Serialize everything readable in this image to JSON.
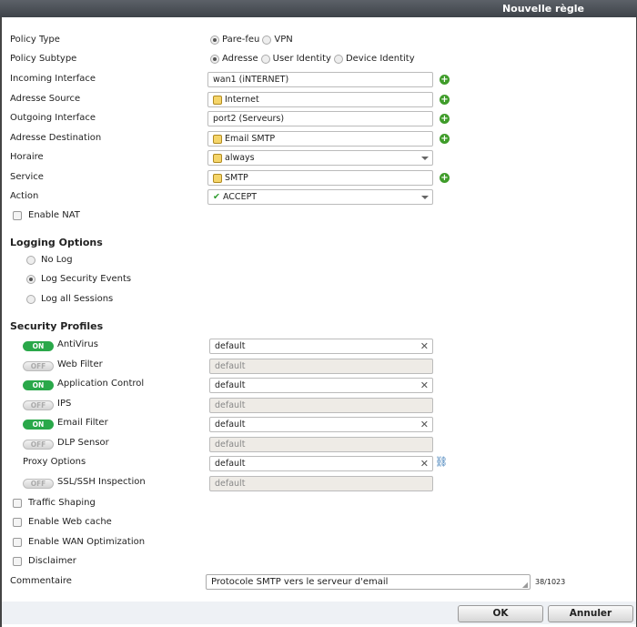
{
  "title": "Nouvelle règle",
  "policy_type": {
    "label": "Policy Type",
    "options": [
      "Pare-feu",
      "VPN"
    ],
    "selected": "Pare-feu"
  },
  "policy_subtype": {
    "label": "Policy Subtype",
    "options": [
      "Adresse",
      "User Identity",
      "Device Identity"
    ],
    "selected": "Adresse"
  },
  "fields": {
    "incoming": {
      "label": "Incoming Interface",
      "value": "wan1 (iNTERNET)"
    },
    "source": {
      "label": "Adresse Source",
      "value": "Internet"
    },
    "outgoing": {
      "label": "Outgoing Interface",
      "value": "port2 (Serveurs)"
    },
    "destination": {
      "label": "Adresse Destination",
      "value": "Email SMTP"
    },
    "horaire": {
      "label": "Horaire",
      "value": "always"
    },
    "service": {
      "label": "Service",
      "value": "SMTP"
    },
    "action": {
      "label": "Action",
      "value": "ACCEPT"
    }
  },
  "enable_nat": {
    "label": "Enable NAT",
    "checked": false
  },
  "logging": {
    "title": "Logging Options",
    "options": [
      "No Log",
      "Log Security Events",
      "Log all Sessions"
    ],
    "selected": "Log Security Events"
  },
  "security": {
    "title": "Security Profiles",
    "on_label": "ON",
    "off_label": "OFF",
    "profiles": [
      {
        "label": "AntiVirus",
        "on": true,
        "value": "default"
      },
      {
        "label": "Web Filter",
        "on": false,
        "value": "default"
      },
      {
        "label": "Application Control",
        "on": true,
        "value": "default"
      },
      {
        "label": "IPS",
        "on": false,
        "value": "default"
      },
      {
        "label": "Email Filter",
        "on": true,
        "value": "default"
      },
      {
        "label": "DLP Sensor",
        "on": false,
        "value": "default"
      },
      {
        "label": "Proxy Options",
        "value": "default"
      },
      {
        "label": "SSL/SSH Inspection",
        "on": false,
        "value": "default"
      }
    ]
  },
  "checks": [
    {
      "label": "Traffic Shaping",
      "checked": false
    },
    {
      "label": "Enable Web cache",
      "checked": false
    },
    {
      "label": "Enable WAN Optimization",
      "checked": false
    },
    {
      "label": "Disclaimer",
      "checked": false
    }
  ],
  "comment": {
    "label": "Commentaire",
    "value": "Protocole SMTP vers le serveur d'email",
    "count": "38/1023"
  },
  "buttons": {
    "ok": "OK",
    "cancel": "Annuler"
  }
}
